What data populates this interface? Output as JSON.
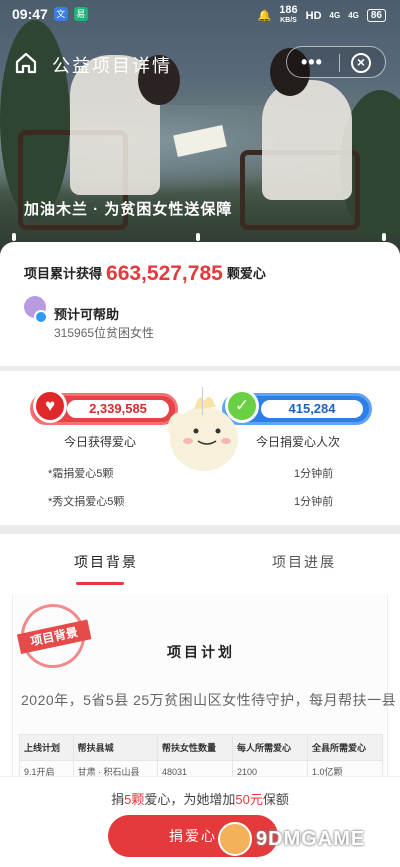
{
  "status_bar": {
    "time": "09:47",
    "net_speed": "186",
    "net_unit": "KB/S",
    "hd": "HD",
    "signal1": "4G",
    "signal2": "4G",
    "battery": "86"
  },
  "nav": {
    "title": "公益项目详情"
  },
  "hero": {
    "caption": "加油木兰 · 为贫困女性送保障"
  },
  "summary": {
    "prefix": "项目累计获得",
    "total": "663,527,785",
    "suffix": "颗爱心",
    "help_title": "预计可帮助",
    "help_sub": "315965位贫困女性"
  },
  "stats": {
    "hearts_value": "2,339,585",
    "hearts_label": "今日获得爱心",
    "donors_value": "415,284",
    "donors_label": "今日捐爱心人次",
    "rows": [
      {
        "left": "*霜捐爱心5颗",
        "right": "1分钟前"
      },
      {
        "left": "*秀文捐爱心5颗",
        "right": "1分钟前"
      }
    ]
  },
  "tabs": [
    {
      "label": "项目背景",
      "active": true
    },
    {
      "label": "项目进展",
      "active": false
    }
  ],
  "content": {
    "stamp": "项目背景",
    "plan_title": "项目计划",
    "plan_text": "2020年，5省5县 25万贫困山区女性待守护，每月帮扶一县",
    "table_headers": [
      "上线计划",
      "帮扶县城",
      "帮扶女性数量",
      "每人所需爱心",
      "全县所需爱心"
    ],
    "table_rows": [
      [
        "9.1开启",
        "甘肃 · 积石山县",
        "48031",
        "2100",
        "1.0亿颗"
      ]
    ]
  },
  "bottom": {
    "prompt_a": "捐",
    "prompt_b": "5颗",
    "prompt_c": "爱心，为她增加",
    "prompt_d": "50元",
    "prompt_e": "保额",
    "donate_label": "捐爱心",
    "watermark": "9DMGAME"
  },
  "colors": {
    "accent": "#e5393b",
    "blue": "#2d7fe8",
    "green": "#6ad043"
  }
}
